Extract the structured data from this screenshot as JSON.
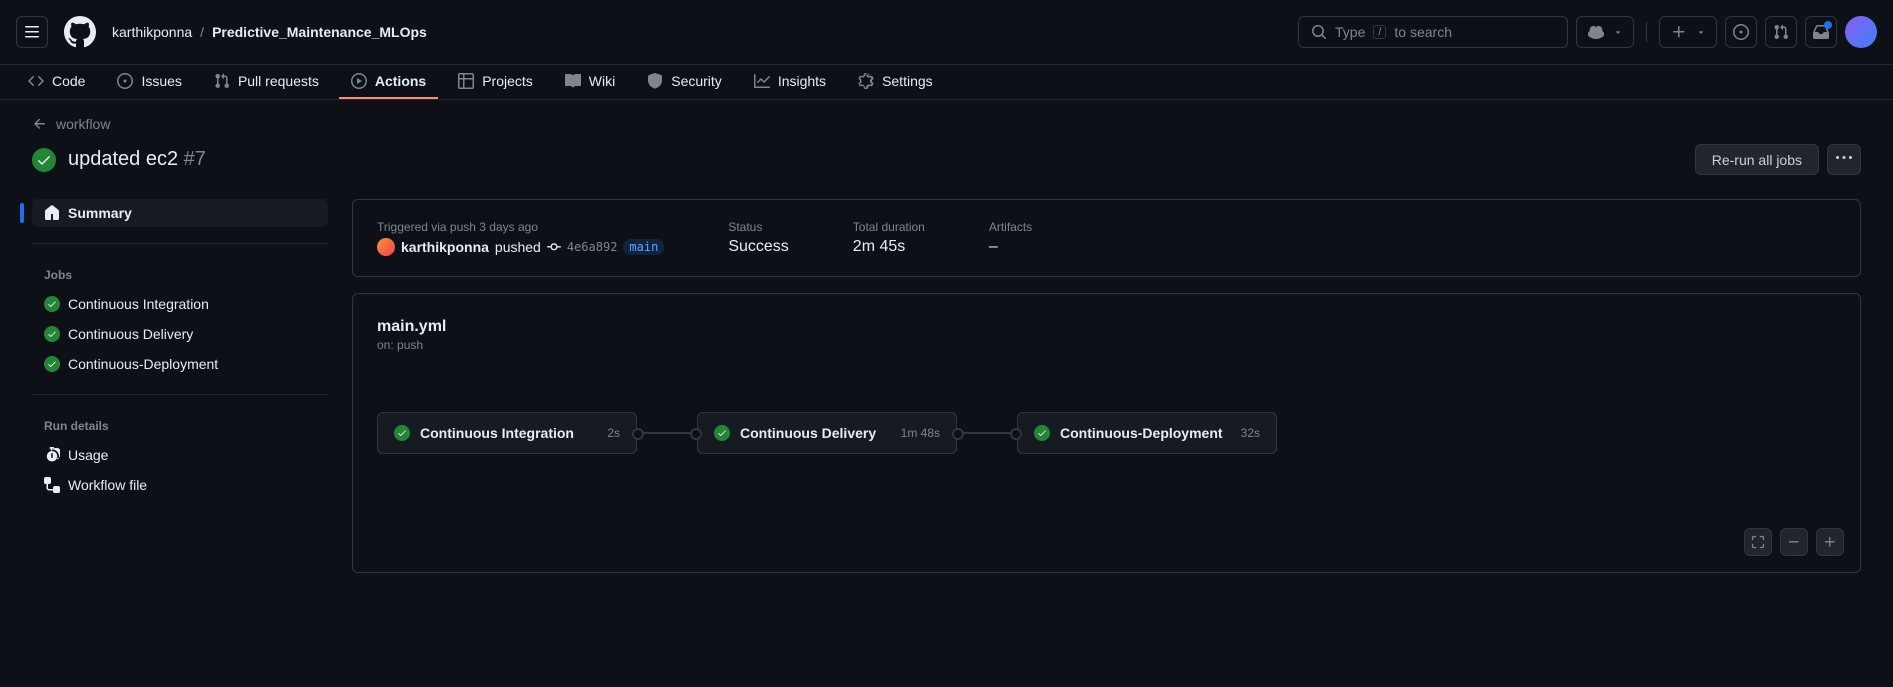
{
  "header": {
    "owner": "karthikponna",
    "repo": "Predictive_Maintenance_MLOps",
    "search_prefix": "Type",
    "search_key": "/",
    "search_suffix": "to search"
  },
  "nav": {
    "code": "Code",
    "issues": "Issues",
    "pulls": "Pull requests",
    "actions": "Actions",
    "projects": "Projects",
    "wiki": "Wiki",
    "security": "Security",
    "insights": "Insights",
    "settings": "Settings"
  },
  "back": "workflow",
  "run": {
    "title": "updated ec2",
    "number": "#7",
    "rerun_btn": "Re-run all jobs"
  },
  "sidebar": {
    "summary": "Summary",
    "jobs_heading": "Jobs",
    "jobs": [
      {
        "name": "Continuous Integration"
      },
      {
        "name": "Continuous Delivery"
      },
      {
        "name": "Continuous-Deployment"
      }
    ],
    "details_heading": "Run details",
    "usage": "Usage",
    "workflow_file": "Workflow file"
  },
  "summary": {
    "trigger_label": "Triggered via push 3 days ago",
    "actor": "karthikponna",
    "action": "pushed",
    "sha": "4e6a892",
    "branch": "main",
    "status_label": "Status",
    "status_value": "Success",
    "duration_label": "Total duration",
    "duration_value": "2m 45s",
    "artifacts_label": "Artifacts",
    "artifacts_value": "–"
  },
  "workflow": {
    "file": "main.yml",
    "on": "on: push",
    "nodes": [
      {
        "name": "Continuous Integration",
        "duration": "2s"
      },
      {
        "name": "Continuous Delivery",
        "duration": "1m 48s"
      },
      {
        "name": "Continuous-Deployment",
        "duration": "32s"
      }
    ]
  }
}
